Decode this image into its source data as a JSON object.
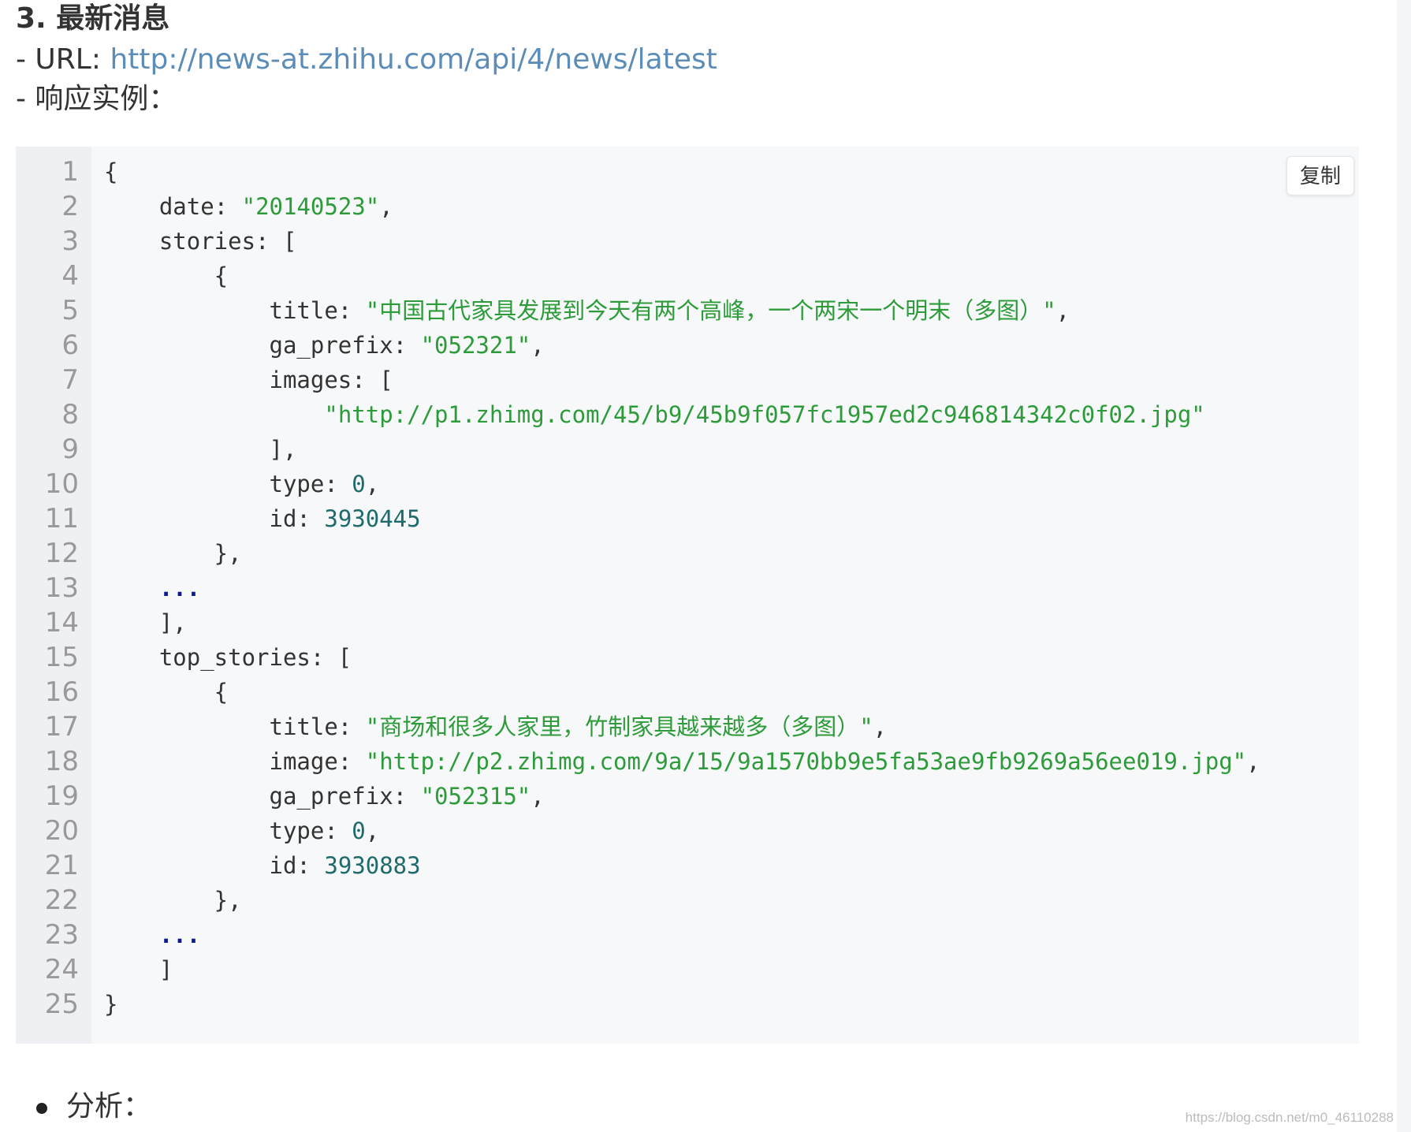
{
  "doc": {
    "heading": "3. 最新消息",
    "url_label": "- URL: ",
    "url_text": "http://news-at.zhihu.com/api/4/news/latest",
    "response_label": "- 响应实例：",
    "analysis_label": "分析：",
    "watermark": "https://blog.csdn.net/m0_46110288"
  },
  "code_block": {
    "copy_label": "复制",
    "line_numbers": [
      "1",
      "2",
      "3",
      "4",
      "5",
      "6",
      "7",
      "8",
      "9",
      "10",
      "11",
      "12",
      "13",
      "14",
      "15",
      "16",
      "17",
      "18",
      "19",
      "20",
      "21",
      "22",
      "23",
      "24",
      "25"
    ],
    "lines": [
      "{",
      "    date: \"20140523\",",
      "    stories: [",
      "        {",
      "            title: \"中国古代家具发展到今天有两个高峰，一个两宋一个明末（多图）\",",
      "            ga_prefix: \"052321\",",
      "            images: [",
      "                \"http://p1.zhimg.com/45/b9/45b9f057fc1957ed2c946814342c0f02.jpg\"",
      "            ],",
      "            type: 0,",
      "            id: 3930445",
      "        },",
      "    ...",
      "    ],",
      "    top_stories: [",
      "        {",
      "            title: \"商场和很多人家里，竹制家具越来越多（多图）\",",
      "            image: \"http://p2.zhimg.com/9a/15/9a1570bb9e5fa53ae9fb9269a56ee019.jpg\",",
      "            ga_prefix: \"052315\",",
      "            type: 0,",
      "            id: 3930883",
      "        },",
      "    ...",
      "    ]",
      "}"
    ]
  }
}
